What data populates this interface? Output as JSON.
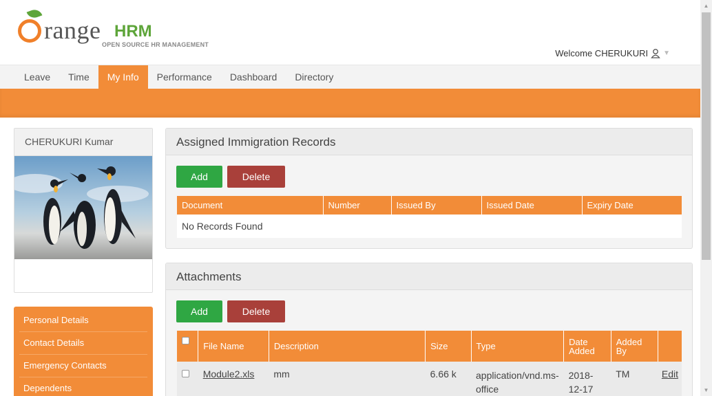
{
  "logo": {
    "word": "range",
    "hrm": "HRM",
    "sub": "OPEN SOURCE HR MANAGEMENT"
  },
  "welcome": "Welcome CHERUKURI",
  "nav": [
    "Leave",
    "Time",
    "My Info",
    "Performance",
    "Dashboard",
    "Directory"
  ],
  "nav_active": "My Info",
  "profile": {
    "name": "CHERUKURI Kumar"
  },
  "sidemenu": [
    "Personal Details",
    "Contact Details",
    "Emergency Contacts",
    "Dependents"
  ],
  "immigration": {
    "title": "Assigned Immigration Records",
    "add": "Add",
    "delete": "Delete",
    "columns": [
      "Document",
      "Number",
      "Issued By",
      "Issued Date",
      "Expiry Date"
    ],
    "empty": "No Records Found"
  },
  "attachments": {
    "title": "Attachments",
    "add": "Add",
    "delete": "Delete",
    "columns": [
      "File Name",
      "Description",
      "Size",
      "Type",
      "Date Added",
      "Added By"
    ],
    "rows": [
      {
        "file": "Module2.xls",
        "description": "mm",
        "size": "6.66 k",
        "type": "application/vnd.ms-office",
        "date": "2018-12-17",
        "by": "TM",
        "action": "Edit"
      }
    ]
  },
  "colors": {
    "accent": "#f28c38",
    "add": "#2fa743",
    "delete": "#a9403a",
    "brand_green": "#5ea53a"
  }
}
